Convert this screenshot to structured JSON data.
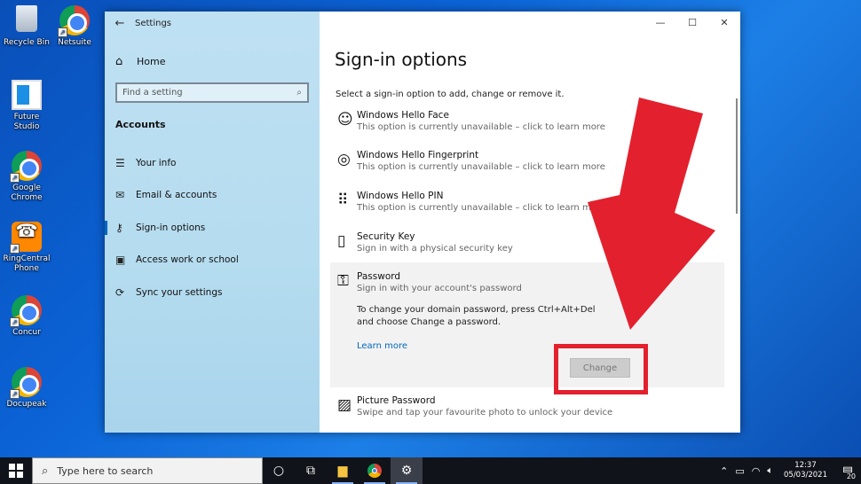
{
  "desktop": {
    "icons": [
      {
        "label": "Recycle Bin"
      },
      {
        "label": "Netsuite"
      },
      {
        "label": "Future Studio"
      },
      {
        "label": "Google Chrome"
      },
      {
        "label": "RingCentral Phone"
      },
      {
        "label": "Concur"
      },
      {
        "label": "Docupeak"
      }
    ]
  },
  "window": {
    "title": "Settings",
    "controls": {
      "minimize": "—",
      "maximize": "☐",
      "close": "✕"
    }
  },
  "sidebar": {
    "home_label": "Home",
    "search_placeholder": "Find a setting",
    "section": "Accounts",
    "items": [
      {
        "label": "Your info",
        "icon": "person-list-icon"
      },
      {
        "label": "Email & accounts",
        "icon": "mail-icon"
      },
      {
        "label": "Sign-in options",
        "icon": "key-icon"
      },
      {
        "label": "Access work or school",
        "icon": "briefcase-icon"
      },
      {
        "label": "Sync your settings",
        "icon": "sync-icon"
      }
    ]
  },
  "main": {
    "title": "Sign-in options",
    "intro": "Select a sign-in option to add, change or remove it.",
    "options": [
      {
        "title": "Windows Hello Face",
        "subtitle": "This option is currently unavailable – click to learn more"
      },
      {
        "title": "Windows Hello Fingerprint",
        "subtitle": "This option is currently unavailable – click to learn more"
      },
      {
        "title": "Windows Hello PIN",
        "subtitle": "This option is currently unavailable – click to learn more"
      },
      {
        "title": "Security Key",
        "subtitle": "Sign in with a physical security key"
      },
      {
        "title": "Password",
        "subtitle": "Sign in with your account's password"
      },
      {
        "title": "Picture Password",
        "subtitle": "Swipe and tap your favourite photo to unlock your device"
      }
    ],
    "password_detail": "To change your domain password, press Ctrl+Alt+Del and choose Change a password.",
    "learn_more": "Learn more",
    "change_button": "Change"
  },
  "taskbar": {
    "search_placeholder": "Type here to search",
    "time": "12:37",
    "date": "05/03/2021",
    "notification_count": "20"
  },
  "colors": {
    "accent": "#0067c0",
    "highlight": "#e3202d"
  }
}
